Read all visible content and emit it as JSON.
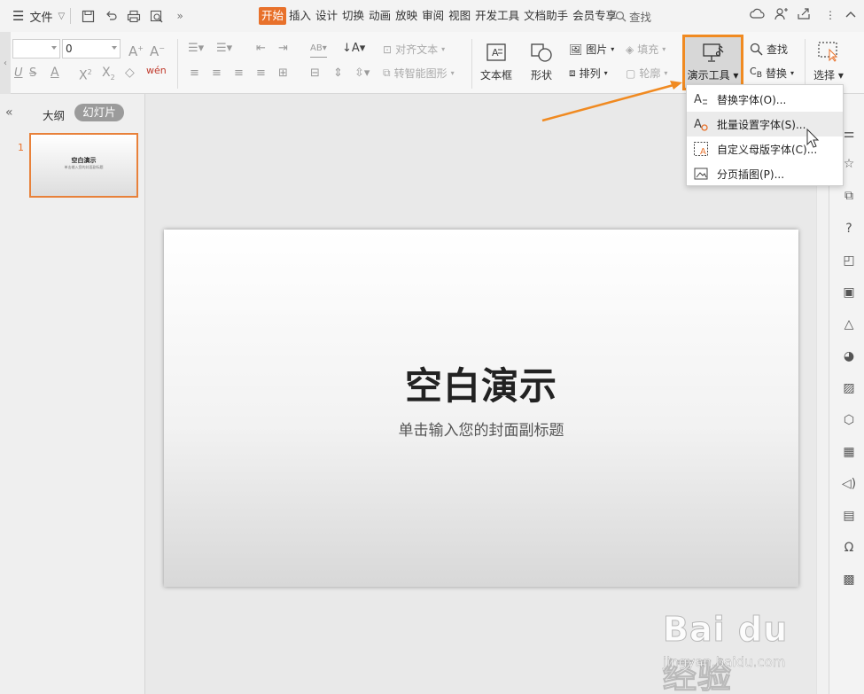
{
  "titlebar": {
    "file_label": "文件",
    "tabs": [
      "开始",
      "插入",
      "设计",
      "切换",
      "动画",
      "放映",
      "审阅",
      "视图",
      "开发工具",
      "文档助手",
      "会员专享"
    ],
    "active_tab": "开始",
    "search_label": "查找"
  },
  "ribbon": {
    "font_name": "",
    "font_size": "0",
    "align_text_label": "对齐文本",
    "smart_shape_label": "转智能图形",
    "textbox_label": "文本框",
    "shape_label": "形状",
    "picture_label": "图片",
    "arrange_label": "排列",
    "fill_label": "填充",
    "outline_label": "轮廓",
    "demo_tools_label": "演示工具",
    "find_label": "查找",
    "replace_label": "替换",
    "select_label": "选择"
  },
  "dropdown": {
    "items": [
      {
        "label": "替换字体(O)..."
      },
      {
        "label": "批量设置字体(S)..."
      },
      {
        "label": "自定义母版字体(C)..."
      },
      {
        "label": "分页插图(P)..."
      }
    ],
    "hovered_index": 1
  },
  "left_panel": {
    "outline_tab": "大纲",
    "slides_tab": "幻灯片",
    "slide_number": "1",
    "thumb_title": "空白演示",
    "thumb_subtitle": "单击输入您的封面副标题"
  },
  "slide": {
    "title": "空白演示",
    "subtitle": "单击输入您的封面副标题"
  },
  "watermark": {
    "main": "Bai du 经验",
    "url": "jingyan.baidu.com"
  },
  "colors": {
    "accent": "#e8712b",
    "highlight_border": "#f08a21"
  }
}
